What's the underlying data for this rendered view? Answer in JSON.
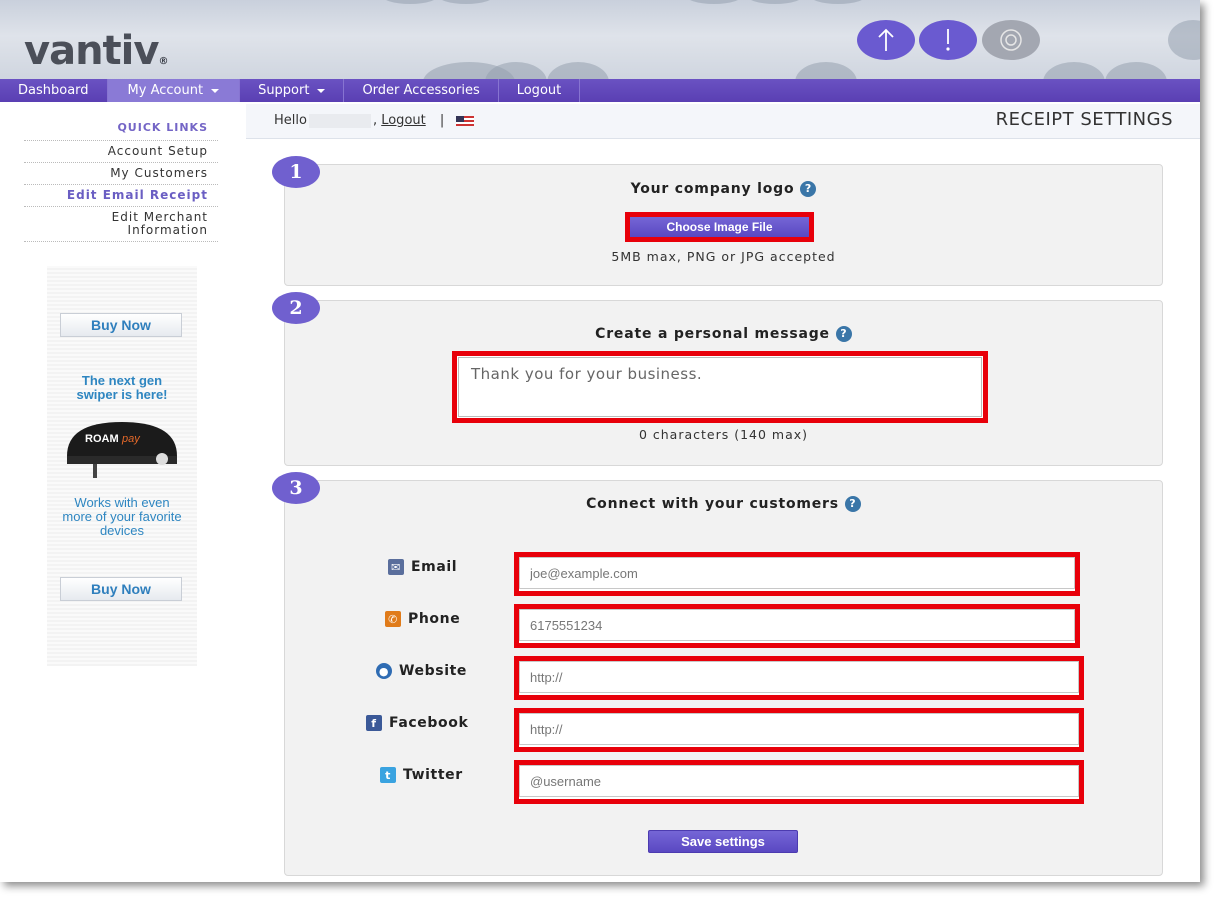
{
  "header": {
    "logo": "vantiv",
    "logo_mark": "®"
  },
  "nav": {
    "items": [
      {
        "label": "Dashboard"
      },
      {
        "label": "My Account"
      },
      {
        "label": "Support"
      },
      {
        "label": "Order Accessories"
      },
      {
        "label": "Logout"
      }
    ]
  },
  "sidebar": {
    "title": "QUICK LINKS",
    "items": [
      {
        "label": "Account Setup"
      },
      {
        "label": "My Customers"
      },
      {
        "label": "Edit Email Receipt"
      },
      {
        "label": "Edit Merchant Information"
      }
    ]
  },
  "promo": {
    "buy_now": "Buy Now",
    "headline": "The next gen swiper is here!",
    "device_brand": "ROAM",
    "device_brand_suffix": "pay",
    "works_text": "Works with even more of your favorite devices"
  },
  "topbar": {
    "hello": "Hello",
    "logout": "Logout",
    "separator": "|",
    "page_title": "RECEIPT SETTINGS"
  },
  "steps": {
    "logo": {
      "number": "1",
      "title": "Your company logo",
      "button": "Choose Image File",
      "note": "5MB max, PNG or JPG accepted"
    },
    "message": {
      "number": "2",
      "title": "Create a personal message",
      "value": "Thank you for your business.",
      "note": "0 characters (140 max)"
    },
    "connect": {
      "number": "3",
      "title": "Connect with your customers",
      "email_label": "Email",
      "email_placeholder": "joe@example.com",
      "phone_label": "Phone",
      "phone_placeholder": "6175551234",
      "website_label": "Website",
      "website_placeholder": "http://",
      "facebook_label": "Facebook",
      "facebook_placeholder": "http://",
      "twitter_label": "Twitter",
      "twitter_placeholder": "@username",
      "save": "Save settings"
    }
  },
  "colors": {
    "accent": "#5a3fb3",
    "highlight": "#e8000a",
    "link": "#2e86c1"
  }
}
